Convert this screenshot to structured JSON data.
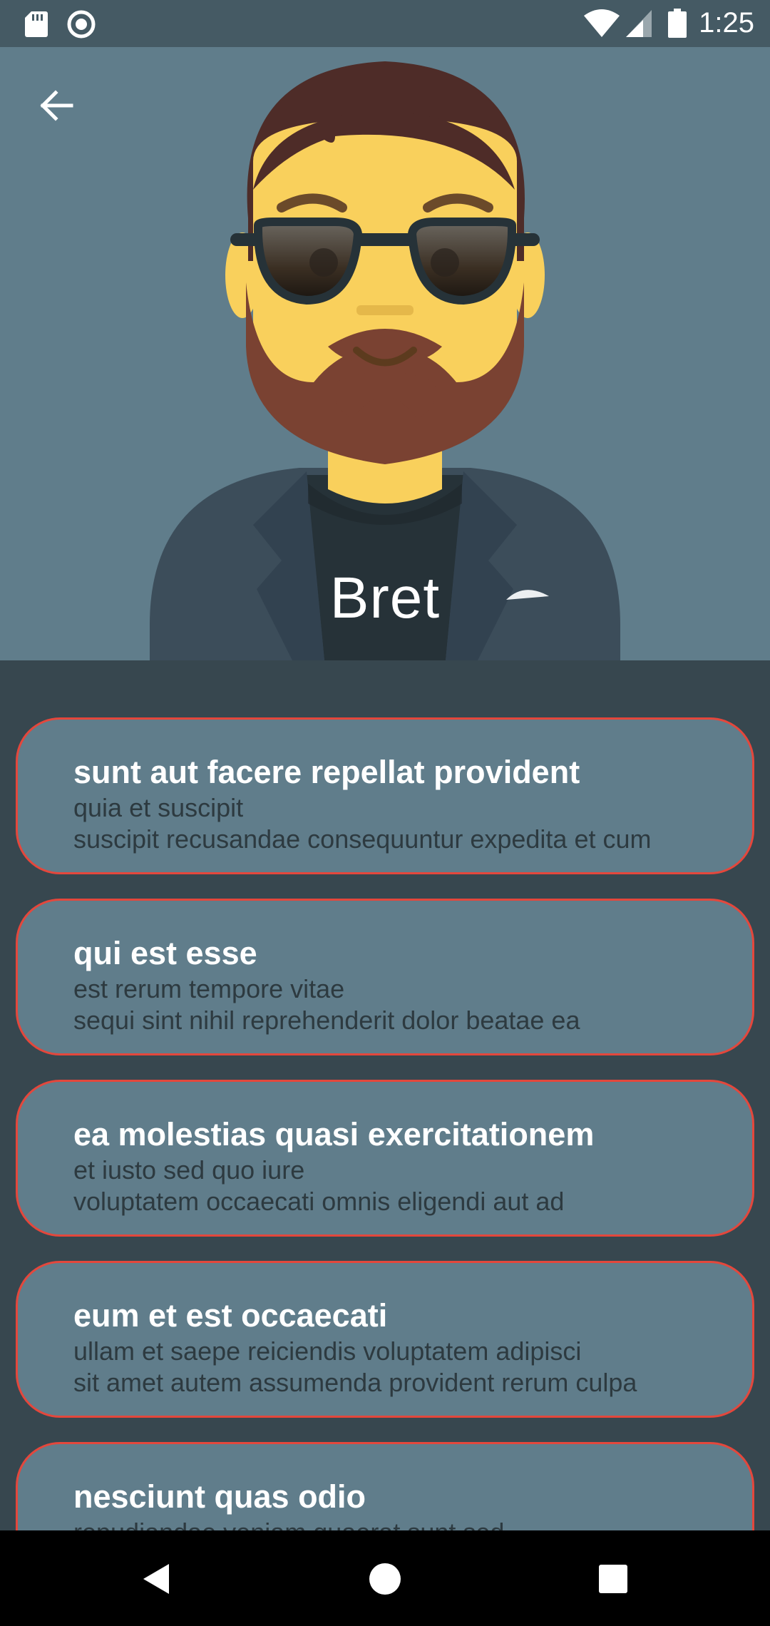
{
  "status_bar": {
    "time": "1:25",
    "icons": [
      "sd-card-icon",
      "sync-icon",
      "wifi-icon",
      "signal-icon",
      "battery-icon"
    ]
  },
  "header": {
    "back_icon": "arrow-back-icon",
    "avatar": "bearded-man-avatar",
    "name": "Bret",
    "background_color": "#607d8b"
  },
  "posts": [
    {
      "title": "sunt aut facere repellat provident",
      "body": "quia et suscipit\nsuscipit recusandae consequuntur expedita et cum"
    },
    {
      "title": "qui est esse",
      "body": "est rerum tempore vitae\nsequi sint nihil reprehenderit dolor beatae ea"
    },
    {
      "title": "ea molestias quasi exercitationem",
      "body": "et iusto sed quo iure\nvoluptatem occaecati omnis eligendi aut ad"
    },
    {
      "title": "eum et est occaecati",
      "body": "ullam et saepe reiciendis voluptatem adipisci\nsit amet autem assumenda provident rerum culpa"
    },
    {
      "title": "nesciunt quas odio",
      "body": "repudiandae veniam quaerat sunt sed"
    }
  ],
  "colors": {
    "card_border": "#e4473c",
    "card_background": "#607d8b",
    "page_background": "#37474f"
  },
  "nav_bar": {
    "buttons": [
      "nav-back-icon",
      "nav-home-icon",
      "nav-recents-icon"
    ]
  }
}
